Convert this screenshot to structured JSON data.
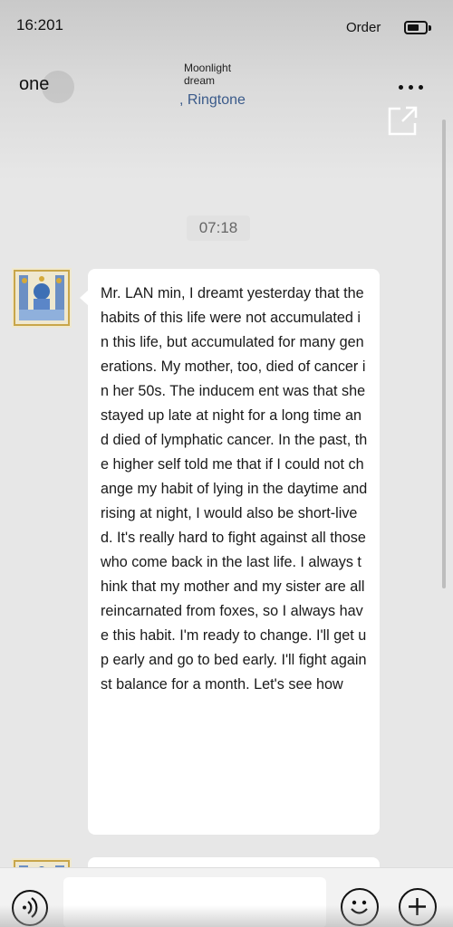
{
  "status_bar": {
    "time": "16:201",
    "carrier": "Order"
  },
  "nav": {
    "back_label": "one",
    "title": "Moonlight dream",
    "subtitle": ", Ringtone"
  },
  "chat": {
    "timestamp": "07:18",
    "messages": [
      {
        "sender": "contact",
        "text": "Mr. LAN min, I dreamt yesterday that the habits of this life were not accumulated in this life, but accumulated for many generations. My mother, too, died of cancer in her 50s. The inducem ent was that she stayed up late at night for a long time and died of lymphatic cancer. In the past, the higher self told me that if I could not change my habit of lying in the daytime and rising at night, I would also be short-lived. It's really hard to fight against all those who come back in the last life. I always think that my mother and my sister are all reincarnated from foxes, so I always have this habit. I'm ready to change. I'll get up early and go to bed early. I'll fight against balance for a month. Let's see how"
      }
    ]
  },
  "input": {
    "placeholder": ""
  },
  "icons": {
    "more": "more-dots-icon",
    "share": "share-icon",
    "voice": "voice-icon",
    "emoji": "emoji-icon",
    "add": "plus-icon"
  }
}
